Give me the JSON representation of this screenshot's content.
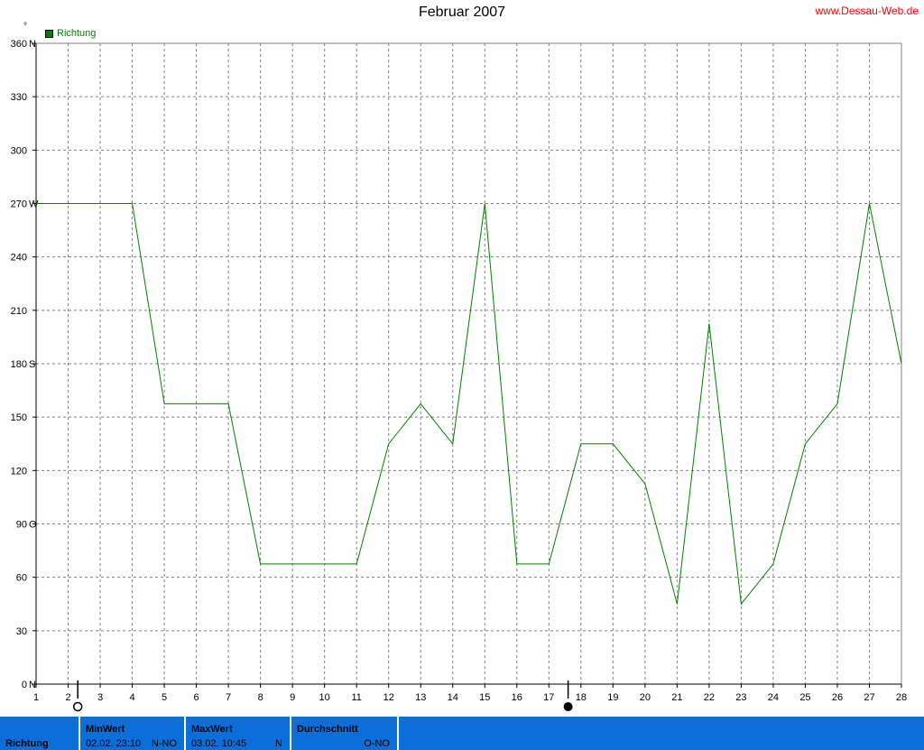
{
  "header": {
    "title": "Februar 2007",
    "site": "www.Dessau-Web.de",
    "unit_symbol": "°"
  },
  "legend": {
    "label": "Richtung",
    "color": "#008000"
  },
  "chart_data": {
    "type": "line",
    "title": "Februar 2007",
    "xlim": [
      1,
      28
    ],
    "ylim": [
      0,
      360
    ],
    "x_ticks": [
      1,
      2,
      3,
      4,
      5,
      6,
      7,
      8,
      9,
      10,
      11,
      12,
      13,
      14,
      15,
      16,
      17,
      18,
      19,
      20,
      21,
      22,
      23,
      24,
      25,
      26,
      27,
      28
    ],
    "y_ticks": [
      {
        "value": 0,
        "label": "0",
        "dir": "N"
      },
      {
        "value": 30,
        "label": "30",
        "dir": ""
      },
      {
        "value": 60,
        "label": "60",
        "dir": ""
      },
      {
        "value": 90,
        "label": "90",
        "dir": "O"
      },
      {
        "value": 120,
        "label": "120",
        "dir": ""
      },
      {
        "value": 150,
        "label": "150",
        "dir": ""
      },
      {
        "value": 180,
        "label": "180",
        "dir": "S"
      },
      {
        "value": 210,
        "label": "210",
        "dir": ""
      },
      {
        "value": 240,
        "label": "240",
        "dir": ""
      },
      {
        "value": 270,
        "label": "270",
        "dir": "W"
      },
      {
        "value": 300,
        "label": "300",
        "dir": ""
      },
      {
        "value": 330,
        "label": "330",
        "dir": ""
      },
      {
        "value": 360,
        "label": "360",
        "dir": "N"
      }
    ],
    "grid": true,
    "legend_position": "top-left",
    "series": [
      {
        "name": "Richtung",
        "color": "#008000",
        "x": [
          1,
          2,
          3,
          4,
          5,
          6,
          7,
          8,
          9,
          10,
          11,
          12,
          13,
          14,
          15,
          16,
          17,
          18,
          19,
          20,
          21,
          22,
          23,
          24,
          25,
          26,
          27,
          28
        ],
        "values": [
          270,
          270,
          270,
          270,
          157.5,
          157.5,
          157.5,
          67.5,
          67.5,
          67.5,
          67.5,
          135,
          157.5,
          135,
          270,
          67.5,
          67.5,
          135,
          135,
          112.5,
          45,
          202.5,
          45,
          67.5,
          135,
          157.5,
          270,
          180
        ]
      }
    ],
    "moon_phases": [
      {
        "day": 2.3,
        "phase": "full-moon"
      },
      {
        "day": 17.6,
        "phase": "new-moon"
      }
    ]
  },
  "stats": {
    "name": "Richtung",
    "min": {
      "label": "MinWert",
      "time": "02.02.  23:10",
      "dir": "N-NO"
    },
    "max": {
      "label": "MaxWert",
      "time": "03.02.  10:45",
      "dir": "N"
    },
    "avg": {
      "label": "Durchschnitt",
      "dir": "O-NO"
    }
  }
}
